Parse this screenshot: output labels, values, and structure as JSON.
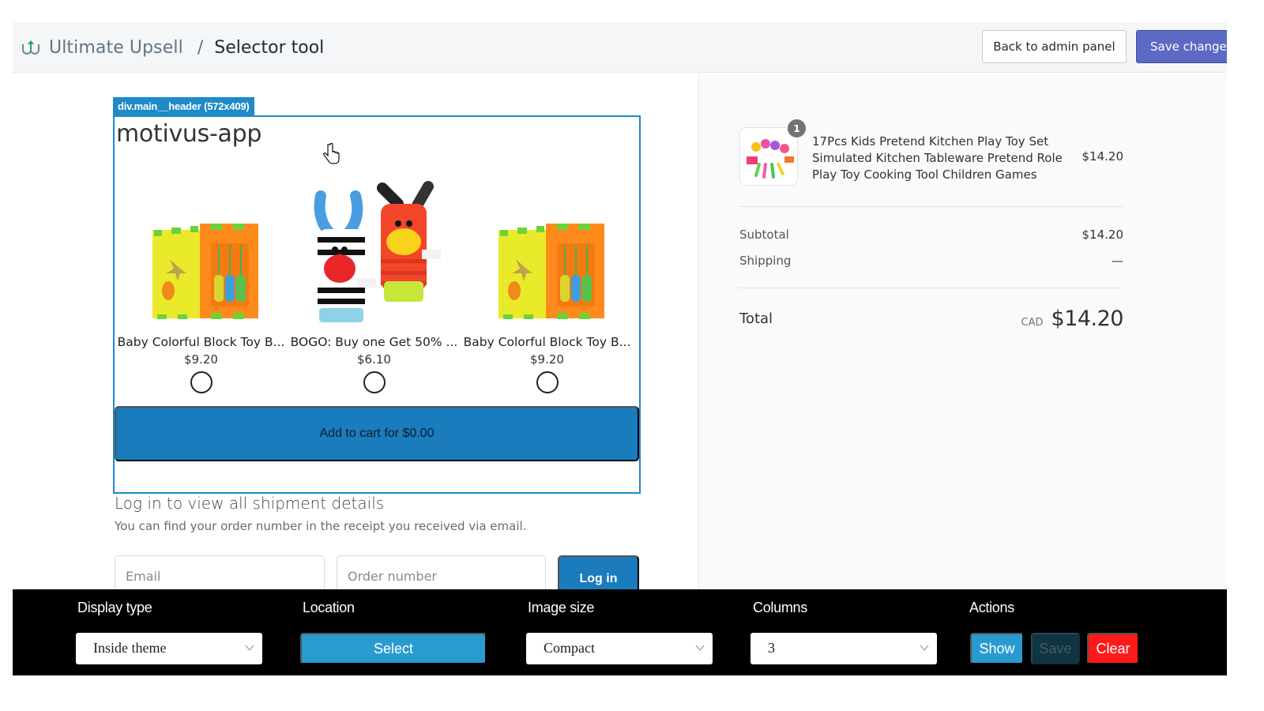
{
  "header": {
    "app_name": "Ultimate Upsell",
    "separator": "/",
    "page_title": "Selector tool",
    "back_button": "Back to admin panel",
    "save_button": "Save changes"
  },
  "selector_overlay": {
    "tag_label": "div.main__header (572x409)"
  },
  "upsell_widget": {
    "store_title": "motivus-app",
    "products": [
      {
        "name": "Baby Colorful Block Toy B...",
        "price": "$9.20",
        "image": "block-toy-cube",
        "selected": false
      },
      {
        "name": "BOGO: Buy one Get 50% ...",
        "price": "$6.10",
        "image": "zebra-giraffe-wrist-rattles",
        "selected": false
      },
      {
        "name": "Baby Colorful Block Toy B...",
        "price": "$9.20",
        "image": "block-toy-cube",
        "selected": false
      }
    ],
    "add_to_cart_label": "Add to cart for $0.00"
  },
  "login_section": {
    "title": "Log in to view all shipment details",
    "subtitle": "You can find your order number in the receipt you received via email.",
    "email_placeholder": "Email",
    "order_placeholder": "Order number",
    "login_button": "Log in"
  },
  "order_summary": {
    "line_items": [
      {
        "quantity": "1",
        "title": "17Pcs Kids Pretend Kitchen Play Toy Set Simulated Kitchen Tableware Pretend Role Play Toy Cooking Tool Children Games",
        "price": "$14.20",
        "image": "kitchen-toy-set"
      }
    ],
    "subtotal_label": "Subtotal",
    "subtotal_value": "$14.20",
    "shipping_label": "Shipping",
    "shipping_value": "—",
    "total_label": "Total",
    "currency": "CAD",
    "total_value": "$14.20"
  },
  "toolbar": {
    "display_type": {
      "label": "Display type",
      "value": "Inside theme"
    },
    "location": {
      "label": "Location",
      "button": "Select"
    },
    "image_size": {
      "label": "Image size",
      "value": "Compact"
    },
    "columns": {
      "label": "Columns",
      "value": "3"
    },
    "actions": {
      "label": "Actions",
      "show": "Show",
      "save": "Save",
      "clear": "Clear"
    }
  },
  "colors": {
    "primary_indigo": "#5c6ac4",
    "selector_blue": "#1f8ac8",
    "cart_button_blue": "#1a7bbd",
    "toolbar_blue": "#2a9bd0",
    "clear_red": "#ff1a1a",
    "toolbar_bg": "#000000"
  }
}
